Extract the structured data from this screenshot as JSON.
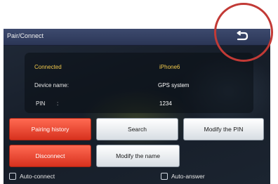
{
  "header": {
    "title": "Pair/Connect",
    "back_icon": "back-arrow-icon"
  },
  "status": {
    "connection_label": "Connected",
    "device_connected": "iPhone6",
    "device_name_label": "Device name:",
    "device_name_value": "GPS system",
    "pin_label": "PIN",
    "pin_separator": ":",
    "pin_value": "1234"
  },
  "buttons": {
    "pairing_history": "Pairing history",
    "search": "Search",
    "modify_pin": "Modify the PIN",
    "disconnect": "Disconnect",
    "modify_name": "Modify the name"
  },
  "options": {
    "auto_connect": "Auto-connect",
    "auto_connect_checked": false,
    "auto_answer": "Auto-answer",
    "auto_answer_checked": false
  },
  "colors": {
    "accent_red": "#e34a33",
    "highlight_yellow": "#f2c94c",
    "annotation_circle": "#c23a36"
  }
}
